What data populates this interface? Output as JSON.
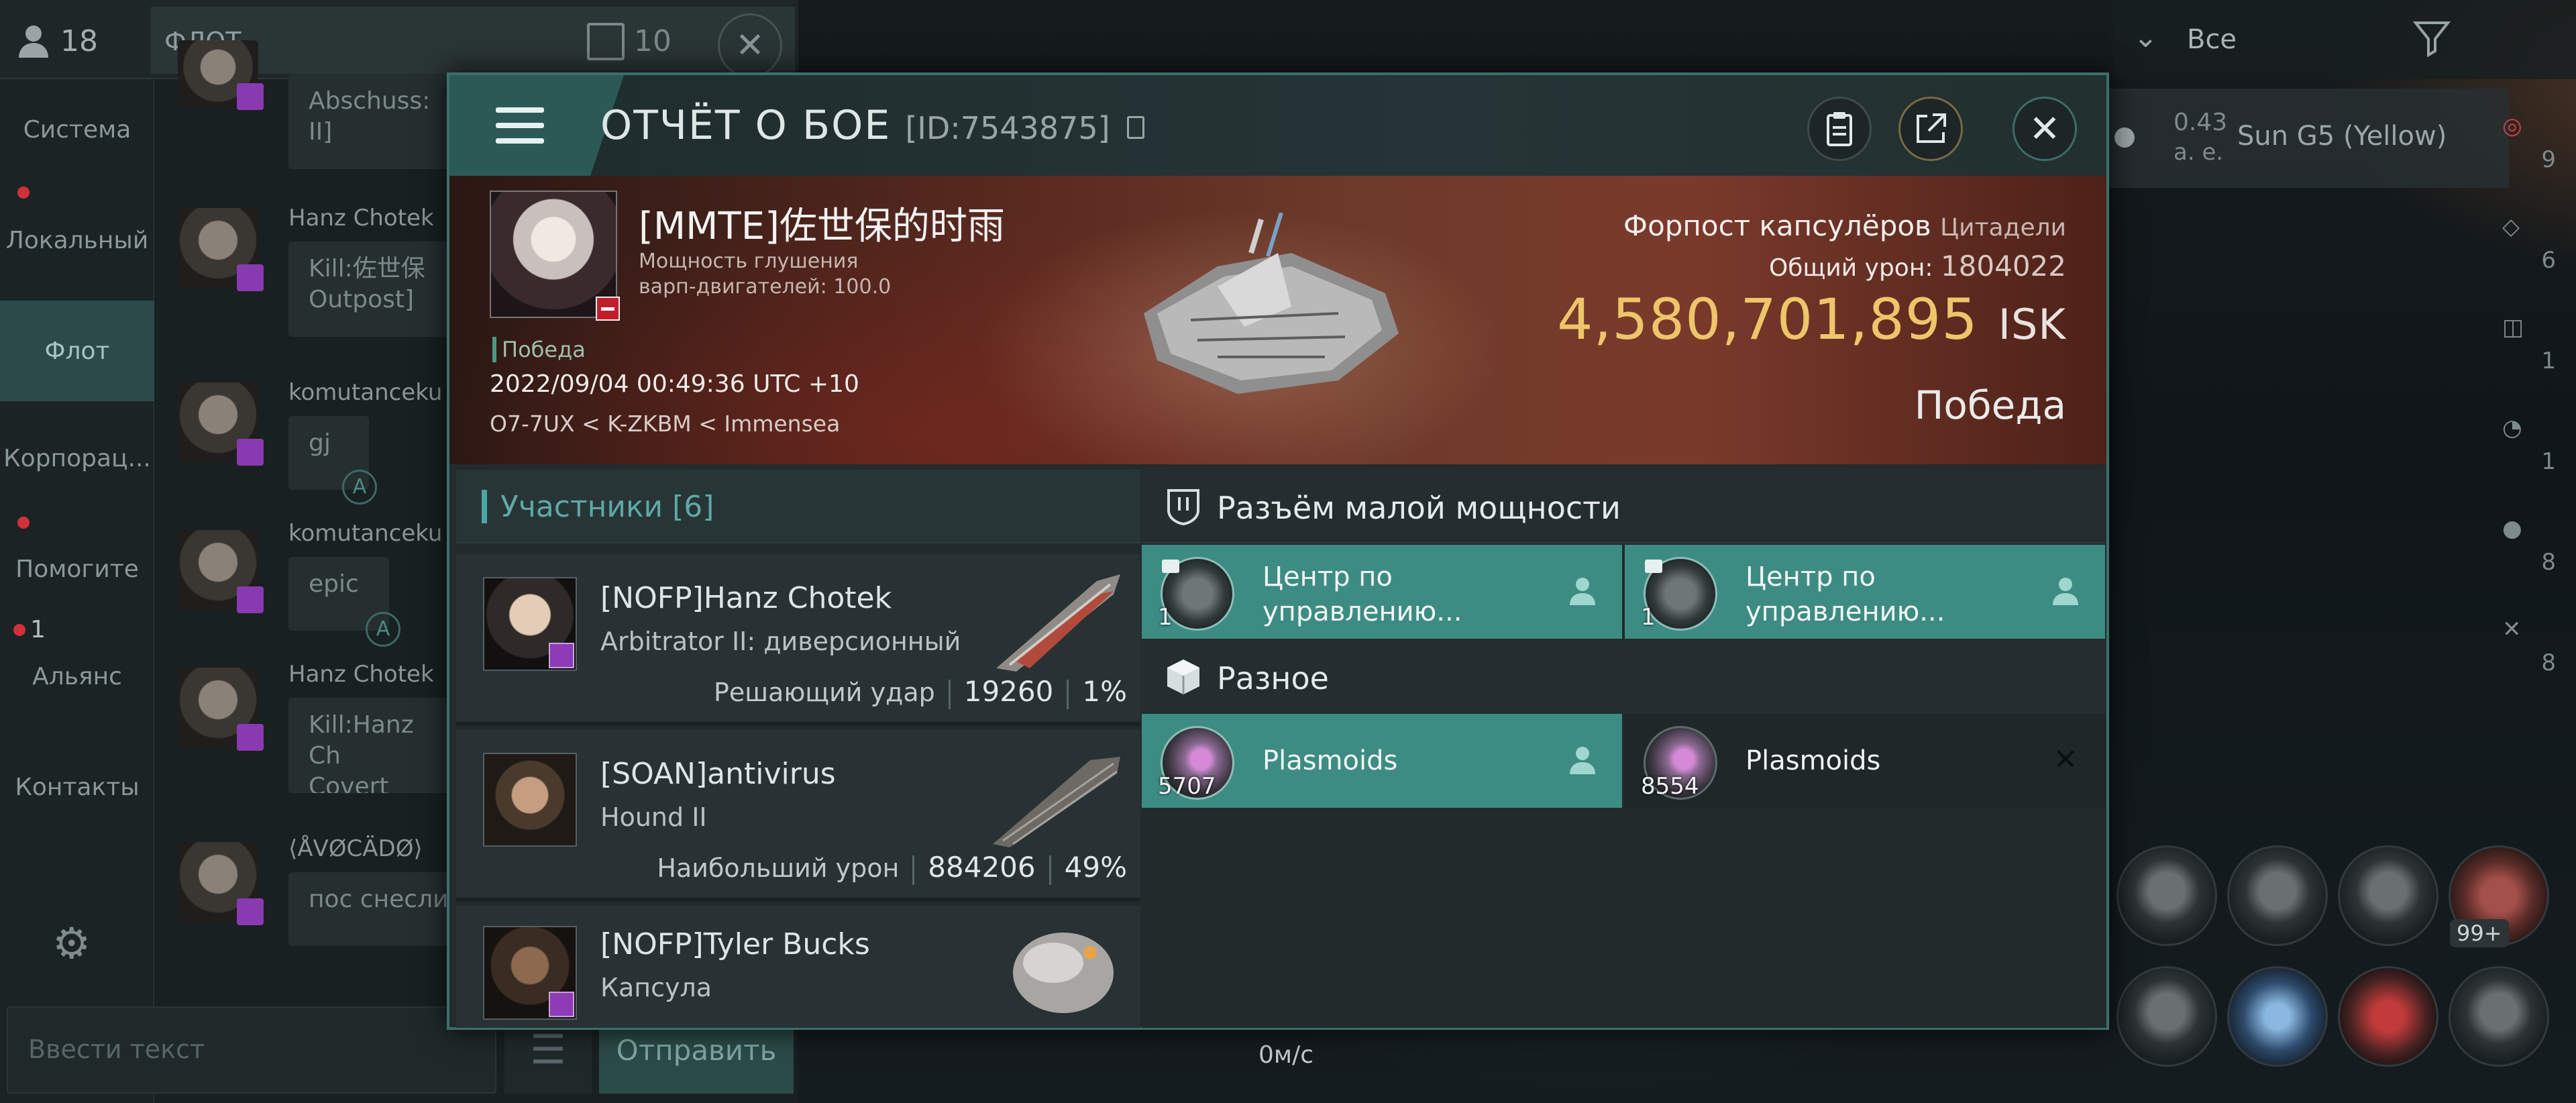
{
  "topbar": {
    "pilot_count": "18",
    "channel_title": "ФЛОТ",
    "fleet_count": "10"
  },
  "chat_nav": [
    {
      "label": "Система"
    },
    {
      "label": "Локальный"
    },
    {
      "label": "Флот"
    },
    {
      "label": "Корпорац..."
    },
    {
      "label": "Помогите"
    },
    {
      "label": "Альянс",
      "badge": "1"
    },
    {
      "label": "Контакты"
    }
  ],
  "chat_messages": [
    {
      "sender": "",
      "text": "Abschuss:\nII]"
    },
    {
      "sender": "Hanz Chotek",
      "text": "Kill:佐世保\nOutpost]"
    },
    {
      "sender": "komutanceku",
      "text": "gj"
    },
    {
      "sender": "komutanceku",
      "text": "epic"
    },
    {
      "sender": "Hanz Chotek",
      "text": "Kill:Hanz Ch\nCovert Ops"
    },
    {
      "sender": "⟨ÅVØCÄDØ⟩",
      "text": "пос снесли"
    }
  ],
  "chat_input": {
    "placeholder": "Ввести текст",
    "send_label": "Отправить"
  },
  "hud": {
    "filter_label": "Все",
    "overview_distance": "0.43",
    "overview_unit": "а. е.",
    "overview_target": "Sun G5 (Yellow)",
    "speed": "0м/с",
    "module_badge": "99+",
    "right_counts": [
      "9",
      "6",
      "1",
      "1",
      "8",
      "8"
    ]
  },
  "report": {
    "title": "ОТЧЁТ О БОЕ",
    "id": "[ID:7543875]",
    "victim": {
      "name": "[MMTE]佐世保的时雨",
      "sub1": "Мощность глушения",
      "sub2": "варп-двигателей: 100.0",
      "tag": "Победа",
      "time": "2022/09/04 00:49:36 UTC +10",
      "location": "O7-7UX < K-ZKBM < Immensea"
    },
    "ship_type": "Форпост капсулёров",
    "ship_class": "Цитадели",
    "total_damage_label": "Общий урон:",
    "total_damage": "1804022",
    "isk_value": "4,580,701,895",
    "isk_unit": "ISK",
    "result": "Победа"
  },
  "participants": {
    "title": "Участники [6]",
    "rows": [
      {
        "name": "[NOFP]Hanz Chotek",
        "ship": "Arbitrator II: диверсионный",
        "role": "Решающий удар",
        "damage": "19260",
        "percent": "1%"
      },
      {
        "name": "[SOAN]antivirus",
        "ship": "Hound II",
        "role": "Наибольший урон",
        "damage": "884206",
        "percent": "49%"
      },
      {
        "name": "[NOFP]Tyler Bucks",
        "ship": "Капсула",
        "role": "",
        "damage": "",
        "percent": ""
      }
    ]
  },
  "loot": {
    "section1_title": "Разъём малой мощности",
    "section2_title": "Разное",
    "low_slot_items": [
      {
        "name": "Центр по управлению...",
        "qty": "1",
        "status": "dropped"
      },
      {
        "name": "Центр по управлению...",
        "qty": "1",
        "status": "dropped"
      }
    ],
    "misc_items": [
      {
        "name": "Plasmoids",
        "qty": "5707",
        "status": "dropped"
      },
      {
        "name": "Plasmoids",
        "qty": "8554",
        "status": "destroyed"
      }
    ]
  },
  "colors": {
    "accent": "#3d8c84",
    "isk": "#eec56a",
    "hostile": "#c11e2b"
  }
}
